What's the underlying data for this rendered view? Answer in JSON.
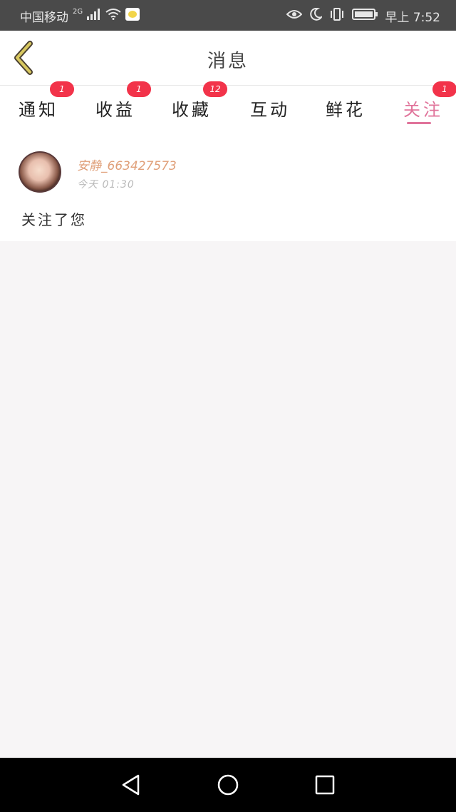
{
  "status_bar": {
    "carrier": "中国移动",
    "network": "2G",
    "time": "早上 7:52"
  },
  "header": {
    "title": "消息"
  },
  "tabs": [
    {
      "label": "通知",
      "badge": "1"
    },
    {
      "label": "收益",
      "badge": "1"
    },
    {
      "label": "收藏",
      "badge": "12"
    },
    {
      "label": "互动",
      "badge": ""
    },
    {
      "label": "鲜花",
      "badge": ""
    },
    {
      "label": "关注",
      "badge": "1",
      "active": true
    }
  ],
  "message": {
    "username": "安静_663427573",
    "time": "今天 01:30",
    "content": "关注了您"
  },
  "colors": {
    "accent": "#e0739a",
    "badge": "#f2334a",
    "username": "#e0a07a",
    "back_chevron": "#c8b85a"
  },
  "icons": {
    "back": "chevron-left-icon",
    "nav_back": "triangle-back-icon",
    "nav_home": "circle-home-icon",
    "nav_recent": "square-recent-icon"
  }
}
